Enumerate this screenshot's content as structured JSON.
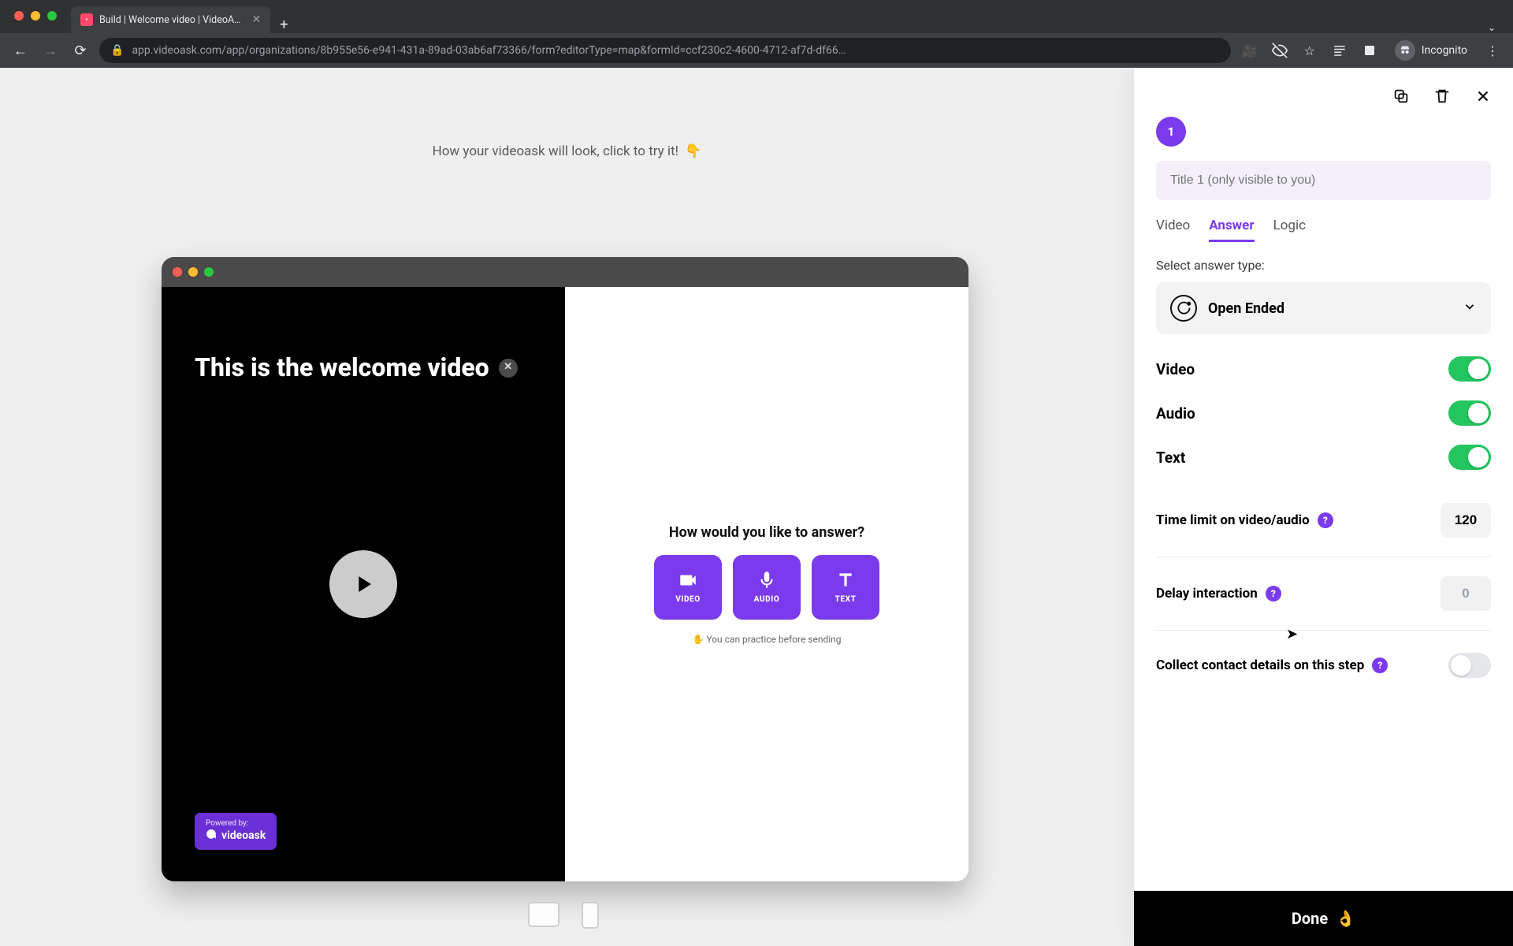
{
  "browser": {
    "tab_title": "Build | Welcome video | VideoA…",
    "url": "app.videoask.com/app/organizations/8b955e56-e941-431a-89ad-03ab6af73366/form?editorType=map&formId=ccf230c2-4600-4712-af7d-df66…",
    "incognito_label": "Incognito"
  },
  "canvas": {
    "caption": "How your videoask will look, click to try it!",
    "caption_emoji": "👇"
  },
  "preview": {
    "overlay_title": "This is the welcome video",
    "question": "How would you like to answer?",
    "answers": {
      "video": "VIDEO",
      "audio": "AUDIO",
      "text": "TEXT"
    },
    "practice_hint": "✋ You can practice before sending",
    "powered_top": "Powered by:",
    "powered_brand": "videoask"
  },
  "panel": {
    "step_number": "1",
    "title_placeholder": "Title 1 (only visible to you)",
    "tabs": {
      "video": "Video",
      "answer": "Answer",
      "logic": "Logic"
    },
    "select_label": "Select answer type:",
    "answer_type": "Open Ended",
    "toggles": {
      "video": "Video",
      "audio": "Audio",
      "text": "Text"
    },
    "time_limit_label": "Time limit on video/audio",
    "time_limit_value": "120",
    "delay_label": "Delay interaction",
    "delay_value": "0",
    "collect_label": "Collect contact details on this step",
    "done_label": "Done",
    "done_emoji": "👌"
  }
}
